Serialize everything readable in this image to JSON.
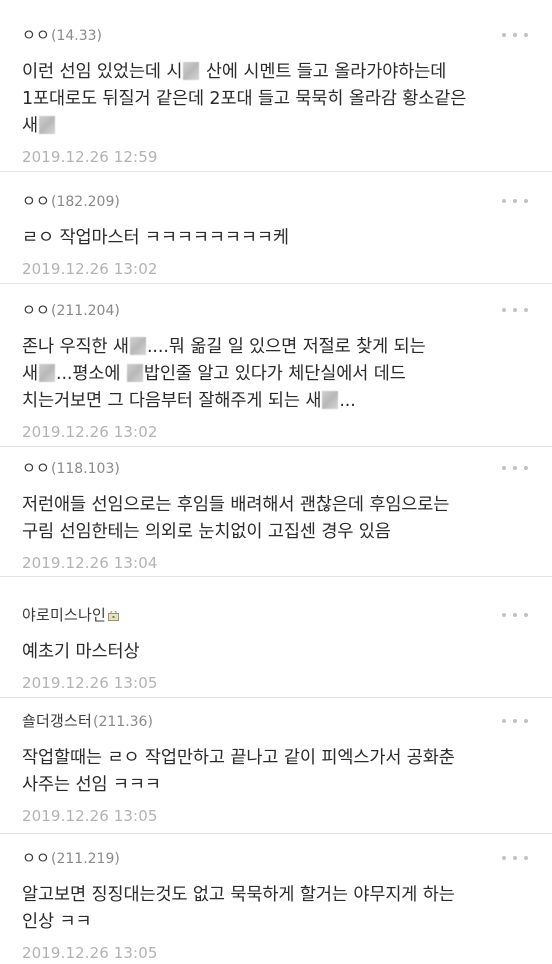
{
  "comments": [
    {
      "nick": "ㅇㅇ",
      "ip": "(14.33)",
      "lines": [
        [
          "이런 선임 있었는데 시",
          "blur",
          " 산에 시멘트 들고 올라가야하는데"
        ],
        [
          "1포대로도 뒤질거 같은데 2포대 들고 묵묵히 올라감 황소같은"
        ],
        [
          "새",
          "blur"
        ]
      ],
      "date": "2019.12.26 12:59"
    },
    {
      "nick": "ㅇㅇ",
      "ip": "(182.209)",
      "lines": [
        [
          "ㄹㅇ 작업마스터 ㅋㅋㅋㅋㅋㅋㅋㅋ케"
        ]
      ],
      "date": "2019.12.26 13:02"
    },
    {
      "nick": "ㅇㅇ",
      "ip": "(211.204)",
      "lines": [
        [
          "존나 우직한 새",
          "blur",
          "....뭐 옮길 일 있으면 저절로 찾게 되는"
        ],
        [
          "새",
          "blur",
          "...평소에 ",
          "blur",
          "밥인줄 알고 있다가 체단실에서 데드"
        ],
        [
          "치는거보면 그 다음부터 잘해주게 되는 새",
          "blur",
          "..."
        ]
      ],
      "date": "2019.12.26 13:02"
    },
    {
      "nick": "ㅇㅇ",
      "ip": "(118.103)",
      "lines": [
        [
          "저런애들 선임으로는 후임들 배려해서 괜찮은데 후임으로는"
        ],
        [
          "구림 선임한테는 의외로 눈치없이 고집센 경우 있음"
        ]
      ],
      "date": "2019.12.26 13:04"
    },
    {
      "nick": "야로미스나인",
      "ip": "",
      "lock": true,
      "lines": [
        [
          "예초기 마스터상"
        ]
      ],
      "date": "2019.12.26 13:05"
    },
    {
      "nick": "숄더갱스터",
      "ip": "(211.36)",
      "lines": [
        [
          "작업할때는 ㄹㅇ 작업만하고 끝나고 같이 피엑스가서 공화춘"
        ],
        [
          "사주는 선임 ㅋㅋㅋ"
        ]
      ],
      "date": "2019.12.26 13:05"
    },
    {
      "nick": "ㅇㅇ",
      "ip": "(211.219)",
      "lines": [
        [
          "알고보면 징징대는것도 없고 묵묵하게 할거는 야무지게 하는"
        ],
        [
          "인상 ㅋㅋ"
        ]
      ],
      "date": "2019.12.26 13:05"
    }
  ]
}
